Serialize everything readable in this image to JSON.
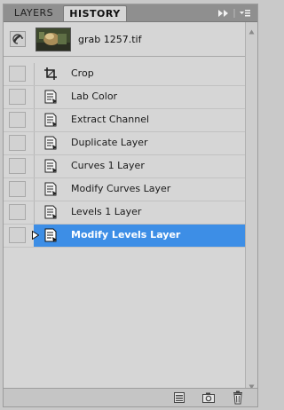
{
  "tabs": [
    {
      "label": "LAYERS",
      "active": false
    },
    {
      "label": "HISTORY",
      "active": true
    }
  ],
  "snapshot": {
    "name": "grab 1257.tif",
    "icon": "history-brush-icon"
  },
  "history_states": [
    {
      "label": "Crop",
      "icon": "crop-icon",
      "selected": false
    },
    {
      "label": "Lab Color",
      "icon": "history-state-icon",
      "selected": false
    },
    {
      "label": "Extract Channel",
      "icon": "history-state-icon",
      "selected": false
    },
    {
      "label": "Duplicate Layer",
      "icon": "history-state-icon",
      "selected": false
    },
    {
      "label": "Curves 1 Layer",
      "icon": "history-state-icon",
      "selected": false
    },
    {
      "label": "Modify Curves Layer",
      "icon": "history-state-icon",
      "selected": false
    },
    {
      "label": "Levels 1 Layer",
      "icon": "history-state-icon",
      "selected": false
    },
    {
      "label": "Modify Levels Layer",
      "icon": "history-state-icon",
      "selected": true
    }
  ],
  "colors": {
    "selection": "#3d8ee6",
    "panel": "#d6d6d6",
    "tabbar": "#8f8f8f"
  },
  "toolbar_icons": [
    "new-document-from-state-icon",
    "new-snapshot-icon",
    "delete-state-icon"
  ]
}
